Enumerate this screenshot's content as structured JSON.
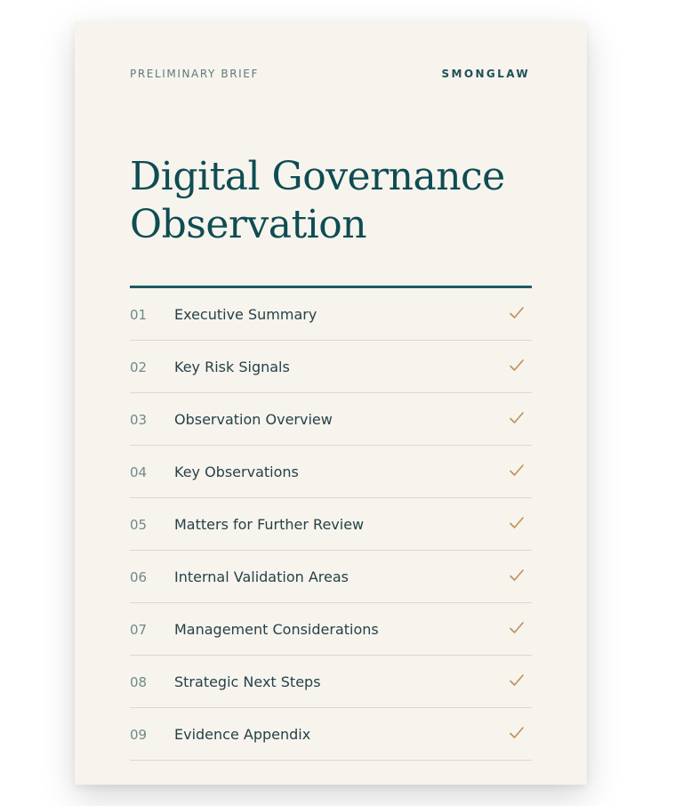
{
  "header": {
    "doc_type": "PRELIMINARY BRIEF",
    "brand": "SMONGLAW"
  },
  "title": {
    "line1": "Digital Governance",
    "line2": "Observation"
  },
  "toc": {
    "items": [
      {
        "number": "01",
        "label": "Executive Summary",
        "icon": "check-icon",
        "checked": true
      },
      {
        "number": "02",
        "label": "Key Risk Signals",
        "icon": "check-icon",
        "checked": true
      },
      {
        "number": "03",
        "label": "Observation Overview",
        "icon": "check-icon",
        "checked": true
      },
      {
        "number": "04",
        "label": "Key Observations",
        "icon": "check-icon",
        "checked": true
      },
      {
        "number": "05",
        "label": "Matters for Further Review",
        "icon": "check-icon",
        "checked": true
      },
      {
        "number": "06",
        "label": "Internal Validation Areas",
        "icon": "check-icon",
        "checked": true
      },
      {
        "number": "07",
        "label": "Management Considerations",
        "icon": "check-icon",
        "checked": true
      },
      {
        "number": "08",
        "label": "Strategic Next Steps",
        "icon": "check-icon",
        "checked": true
      },
      {
        "number": "09",
        "label": "Evidence Appendix",
        "icon": "check-icon",
        "checked": true
      }
    ]
  },
  "colors": {
    "page_background": "#f7f4ee",
    "title": "#0f4c53",
    "rule": "#1e5b61",
    "check": "#c18f55",
    "number": "#6f8a88",
    "label": "#264148"
  }
}
